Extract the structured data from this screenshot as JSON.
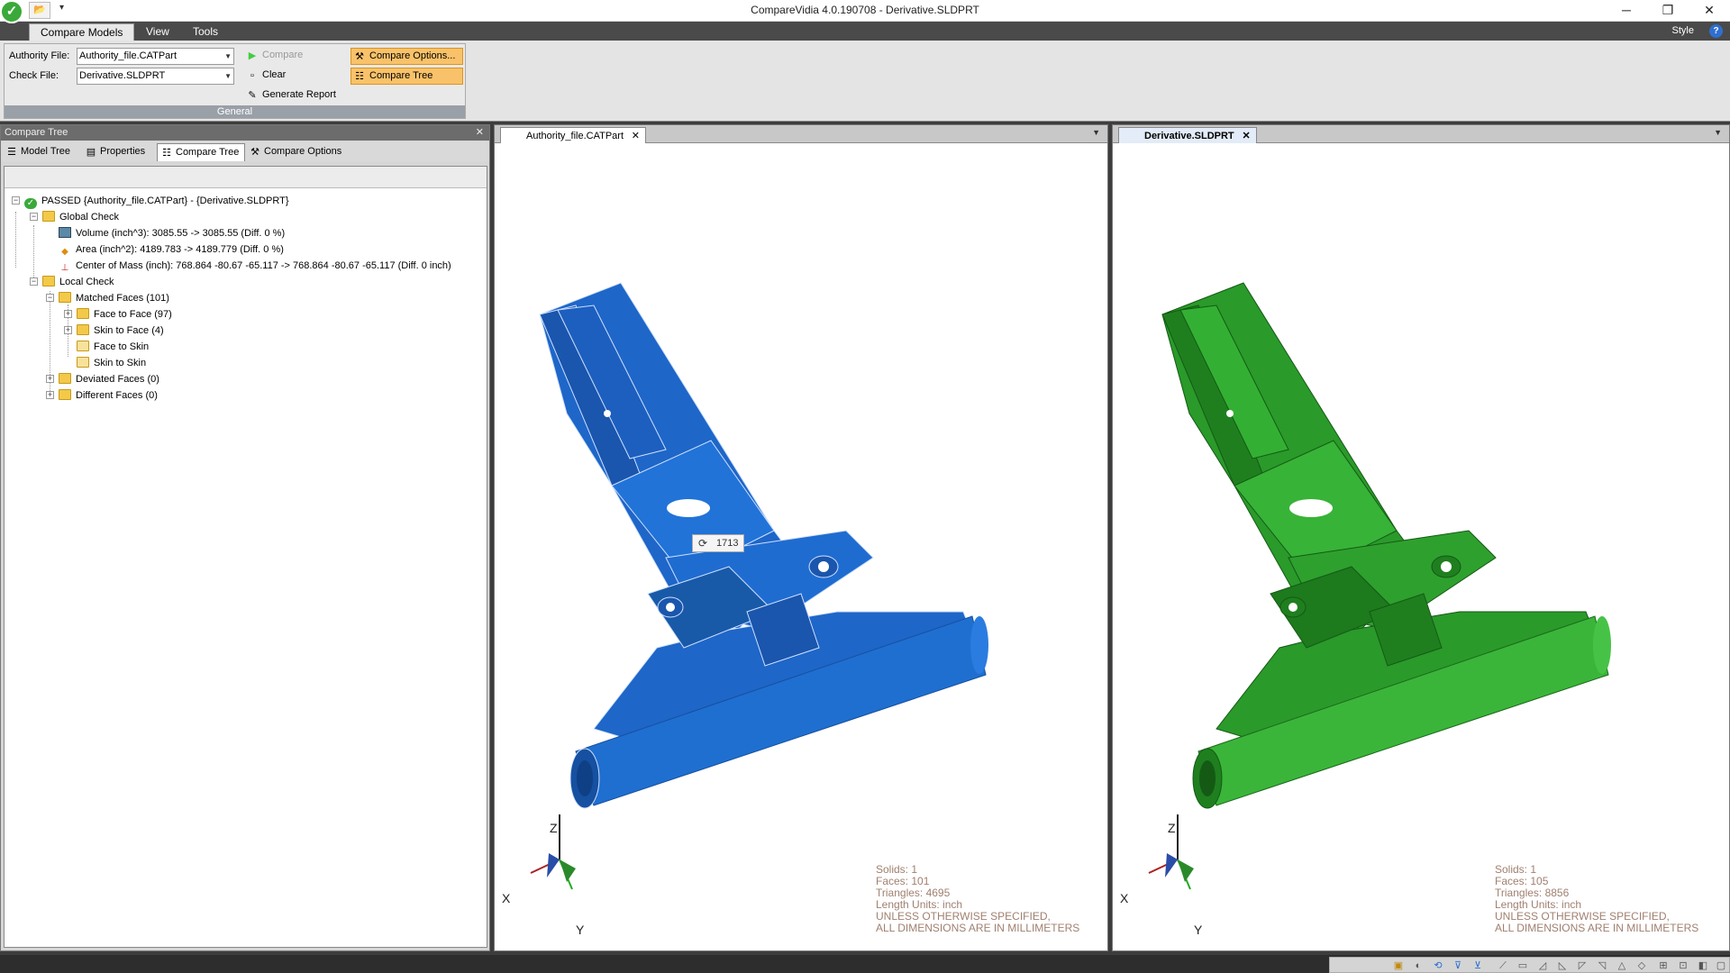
{
  "window": {
    "title": "CompareVidia 4.0.190708 - Derivative.SLDPRT",
    "minimize": "─",
    "restore": "❐",
    "close": "✕"
  },
  "qat": {
    "open_icon": "📂",
    "more": "▾"
  },
  "ribbon_tabs": [
    "Compare Models",
    "View",
    "Tools"
  ],
  "style_label": "Style",
  "help": "?",
  "ribbon": {
    "group_label": "General",
    "authority_label": "Authority File:",
    "authority_value": "Authority_file.CATPart",
    "check_label": "Check File:",
    "check_value": "Derivative.SLDPRT",
    "compare": "Compare",
    "clear": "Clear",
    "generate_report": "Generate Report",
    "compare_options": "Compare Options...",
    "compare_tree": "Compare Tree"
  },
  "panel": {
    "title": "Compare Tree",
    "tabs": [
      "Model Tree",
      "Properties",
      "Compare Tree",
      "Compare Options"
    ]
  },
  "tree": [
    {
      "text": "PASSED {Authority_file.CATPart} - {Derivative.SLDPRT}",
      "icon": "check-icon"
    },
    {
      "text": "Global Check",
      "icon": "folder-icon"
    },
    {
      "text": "Volume (inch^3): 3085.55 -> 3085.55 (Diff. 0 %)",
      "icon": "volume-icon"
    },
    {
      "text": "Area (inch^2): 4189.783 -> 4189.779 (Diff. 0 %)",
      "icon": "area-icon"
    },
    {
      "text": "Center of Mass (inch): 768.864 -80.67 -65.117 -> 768.864 -80.67 -65.117 (Diff. 0 inch)",
      "icon": "axes-icon"
    },
    {
      "text": "Local Check",
      "icon": "folder-icon"
    },
    {
      "text": "Matched Faces (101)",
      "icon": "folder-icon"
    },
    {
      "text": "Face to Face (97)",
      "icon": "folder-icon"
    },
    {
      "text": "Skin to Face (4)",
      "icon": "folder-icon"
    },
    {
      "text": "Face to Skin",
      "icon": "folder-icon"
    },
    {
      "text": "Skin to Skin",
      "icon": "folder-icon"
    },
    {
      "text": "Deviated Faces (0)",
      "icon": "folder-icon"
    },
    {
      "text": "Different Faces (0)",
      "icon": "folder-icon"
    }
  ],
  "view_left": {
    "tab": "Authority_file.CATPart",
    "model_color": "#1f6fd1",
    "tooltip": "1713",
    "info": [
      "Solids: 1",
      "Faces: 101",
      "Triangles: 4695",
      "Length Units: inch",
      "UNLESS OTHERWISE SPECIFIED,",
      "ALL DIMENSIONS ARE IN MILLIMETERS"
    ]
  },
  "view_right": {
    "tab": "Derivative.SLDPRT",
    "model_color": "#2ea02e",
    "info": [
      "Solids: 1",
      "Faces: 105",
      "Triangles: 8856",
      "Length Units: inch",
      "UNLESS OTHERWISE SPECIFIED,",
      "ALL DIMENSIONS ARE IN MILLIMETERS"
    ]
  },
  "triad": {
    "x": "X",
    "y": "Y",
    "z": "Z"
  },
  "close_glyph": "✕",
  "dropdown_glyph": "▼"
}
